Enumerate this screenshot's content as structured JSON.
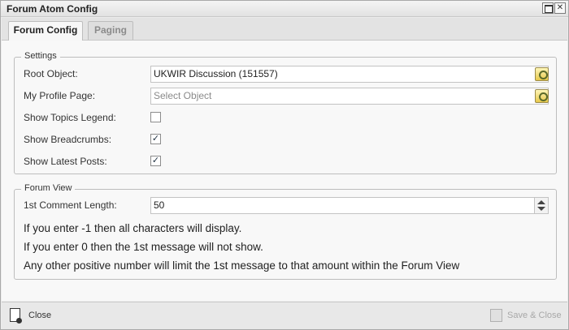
{
  "window": {
    "title": "Forum Atom Config",
    "close_glyph": "✕"
  },
  "tabs": [
    {
      "label": "Forum Config",
      "active": true
    },
    {
      "label": "Paging",
      "active": false
    }
  ],
  "settings": {
    "legend": "Settings",
    "root_object": {
      "label": "Root Object:",
      "value": "UKWIR Discussion (151557)",
      "clear_glyph": "✕"
    },
    "my_profile_page": {
      "label": "My Profile Page:",
      "placeholder": "Select Object"
    },
    "show_topics_legend": {
      "label": "Show Topics Legend:",
      "checked": false,
      "mark": ""
    },
    "show_breadcrumbs": {
      "label": "Show Breadcrumbs:",
      "checked": true,
      "mark": "✓"
    },
    "show_latest_posts": {
      "label": "Show Latest Posts:",
      "checked": true,
      "mark": "✓"
    }
  },
  "forum_view": {
    "legend": "Forum View",
    "comment_length": {
      "label": "1st Comment Length:",
      "value": "50"
    },
    "info_lines": [
      "If you enter -1 then all characters will display.",
      "If you enter 0 then the 1st message will not show.",
      "Any other positive number will limit the 1st message to that amount within the Forum View"
    ]
  },
  "footer": {
    "close_label": "Close",
    "save_close_label": "Save & Close"
  },
  "icons": {
    "picker": "object-picker-icon",
    "close": "document-close-icon",
    "save": "save-icon"
  }
}
